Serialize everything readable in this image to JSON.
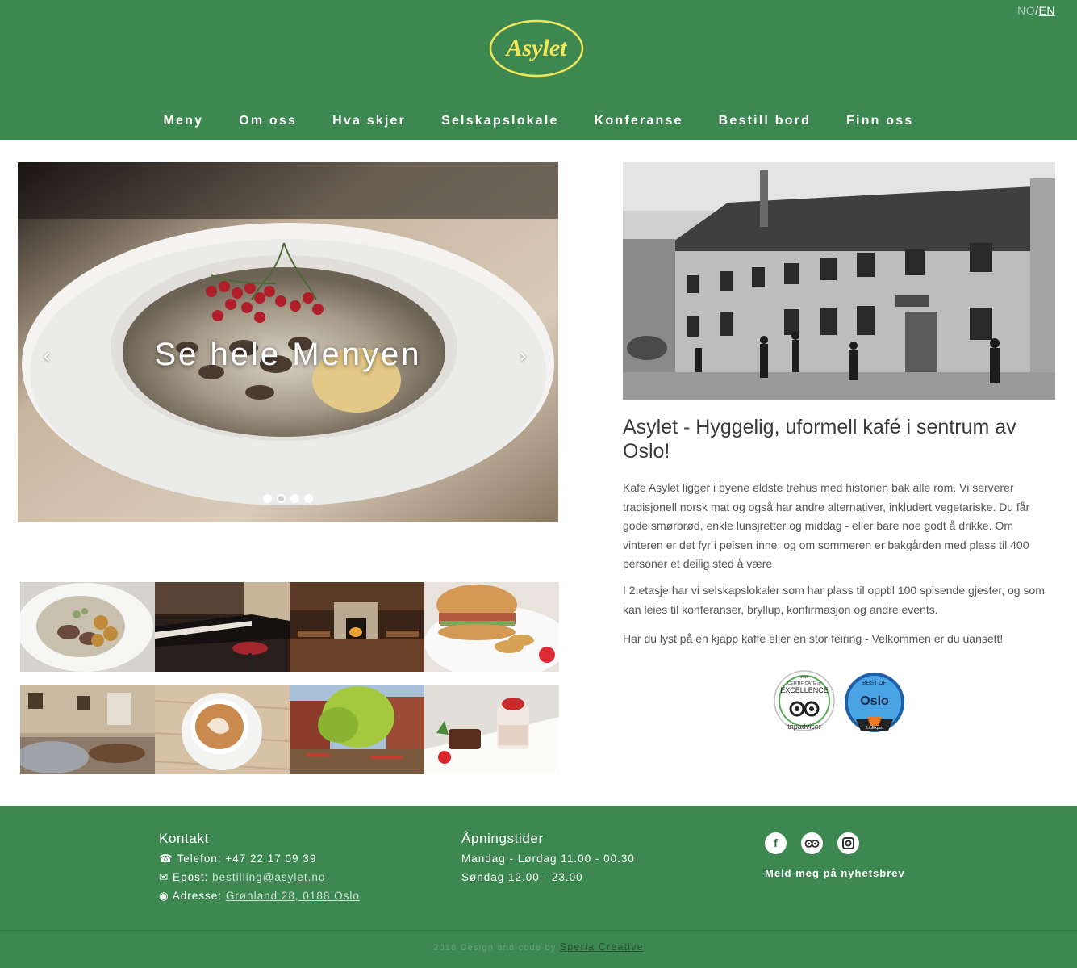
{
  "header": {
    "logo_text": "Asylet",
    "lang": {
      "no": "NO",
      "sep": "/",
      "en": "EN"
    },
    "nav": [
      "Meny",
      "Om oss",
      "Hva skjer",
      "Selskapslokale",
      "Konferanse",
      "Bestill bord",
      "Finn oss"
    ]
  },
  "slider": {
    "caption": "Se hele Menyen",
    "prev": "‹",
    "next": "›",
    "dots_total": 4,
    "active_dot": 2
  },
  "gallery": {
    "thumbs": [
      "game-stew",
      "piano",
      "fireplace-room",
      "burger",
      "lounge",
      "cappuccino",
      "courtyard",
      "dessert"
    ]
  },
  "about": {
    "headline": "Asylet - Hyggelig, uformell kafé i sentrum av Oslo!",
    "p1": "Kafe Asylet ligger i byene eldste trehus med historien bak alle rom. Vi serverer tradisjonell norsk mat og også har andre alternativer, inkludert vegetariske. Du får gode smørbrød, enkle lunsjretter og middag - eller bare noe godt å drikke. Om vinteren er det fyr i peisen inne, og om sommeren er bakgården med plass til 400 personer et deilig sted å være.",
    "p2": "I 2.etasje har vi selskapslokaler som har plass til opptil 100 spisende gjester, og som kan leies til konferanser, bryllup, konfirmasjon og andre events.",
    "p3": "Har du lyst på en kjapp kaffe eller en stor feiring - Velkommen er du uansett!"
  },
  "badges": {
    "tripadvisor": {
      "year": "2017",
      "line1": "CERTIFICATE of",
      "line2": "EXCELLENCE",
      "brand": "tripadvisor"
    },
    "oslo": {
      "top": "BEST OF",
      "city": "Oslo",
      "brand": "TripExpert"
    }
  },
  "footer": {
    "contact_title": "Kontakt",
    "phone_label": "☎ Telefon: +47 22 17 09 39",
    "email_label": "✉ Epost: ",
    "email": "bestilling@asylet.no",
    "address_label": "◉ Adresse: ",
    "address": "Grønland 28, 0188 Oslo",
    "hours_title": "Åpningstider",
    "hours1": "Mandag - Lørdag 11.00 - 00.30",
    "hours2": "Søndag 12.00 - 23.00",
    "newsletter": "Meld meg på nyhetsbrev",
    "credit_text": "2018 Design and code by ",
    "credit_link": "Speria Creative",
    "social": [
      "facebook-icon",
      "tripadvisor-icon",
      "instagram-icon"
    ]
  },
  "colors": {
    "brand_green": "#3d8751",
    "logo_yellow": "#f2e65a"
  }
}
